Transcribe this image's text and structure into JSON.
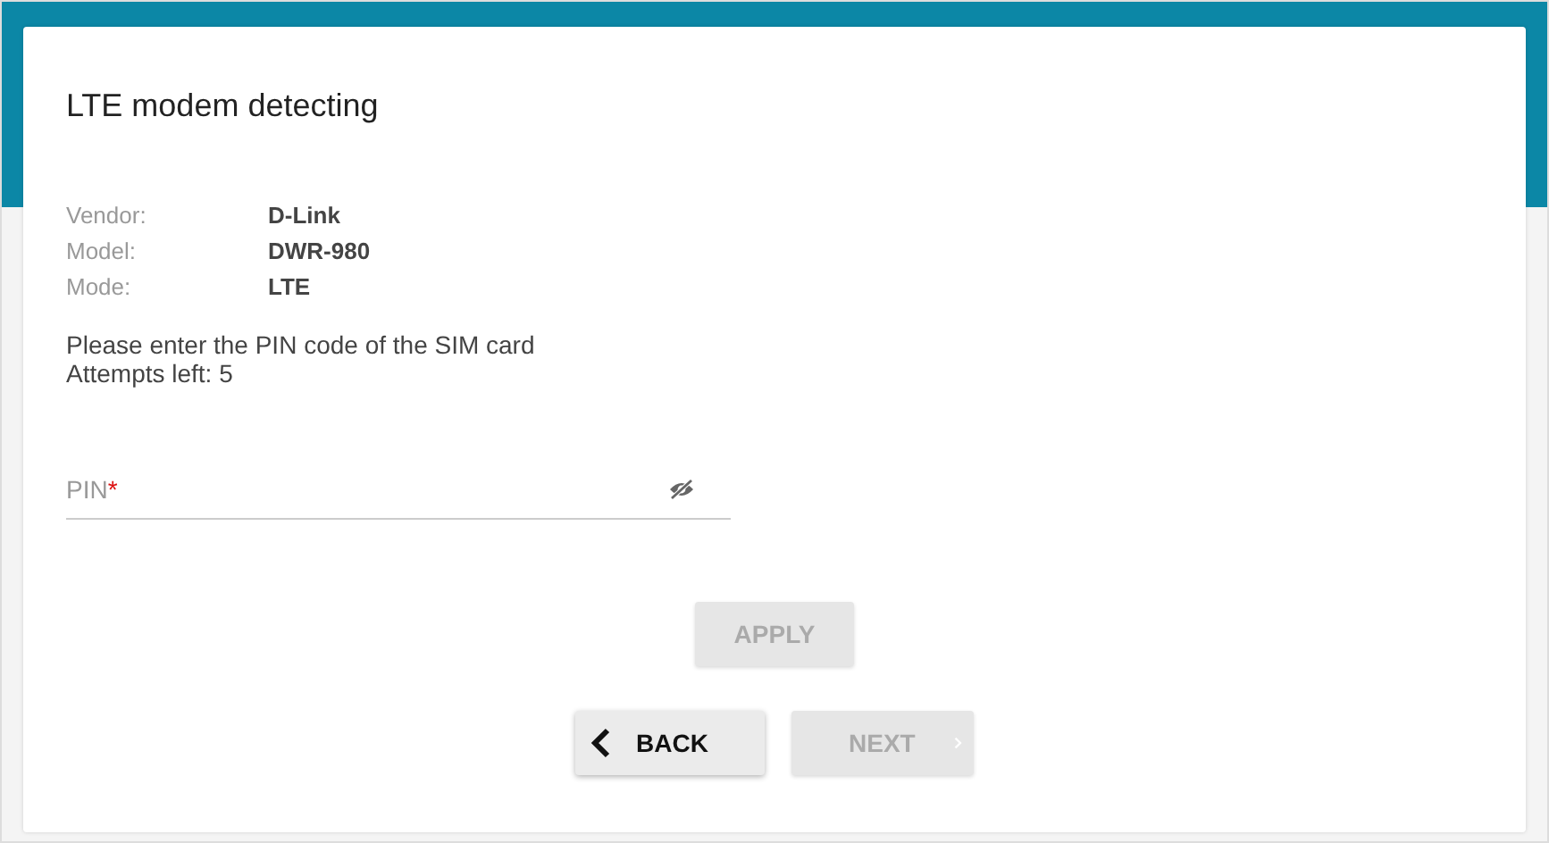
{
  "title": "LTE modem detecting",
  "info": [
    {
      "label": "Vendor:",
      "value": "D-Link"
    },
    {
      "label": "Model:",
      "value": "DWR-980"
    },
    {
      "label": "Mode:",
      "value": "LTE"
    }
  ],
  "message": [
    "Please enter the PIN code of the SIM card",
    "Attempts left: 5"
  ],
  "pin_field": {
    "placeholder": "PIN",
    "required_mark": "*",
    "password_hidden": true
  },
  "apply_button": {
    "label": "APPLY",
    "disabled": true
  },
  "nav_buttons": [
    {
      "kind": "back",
      "label": "BACK",
      "disabled": false
    },
    {
      "kind": "next",
      "label": "NEXT",
      "disabled": true
    }
  ]
}
